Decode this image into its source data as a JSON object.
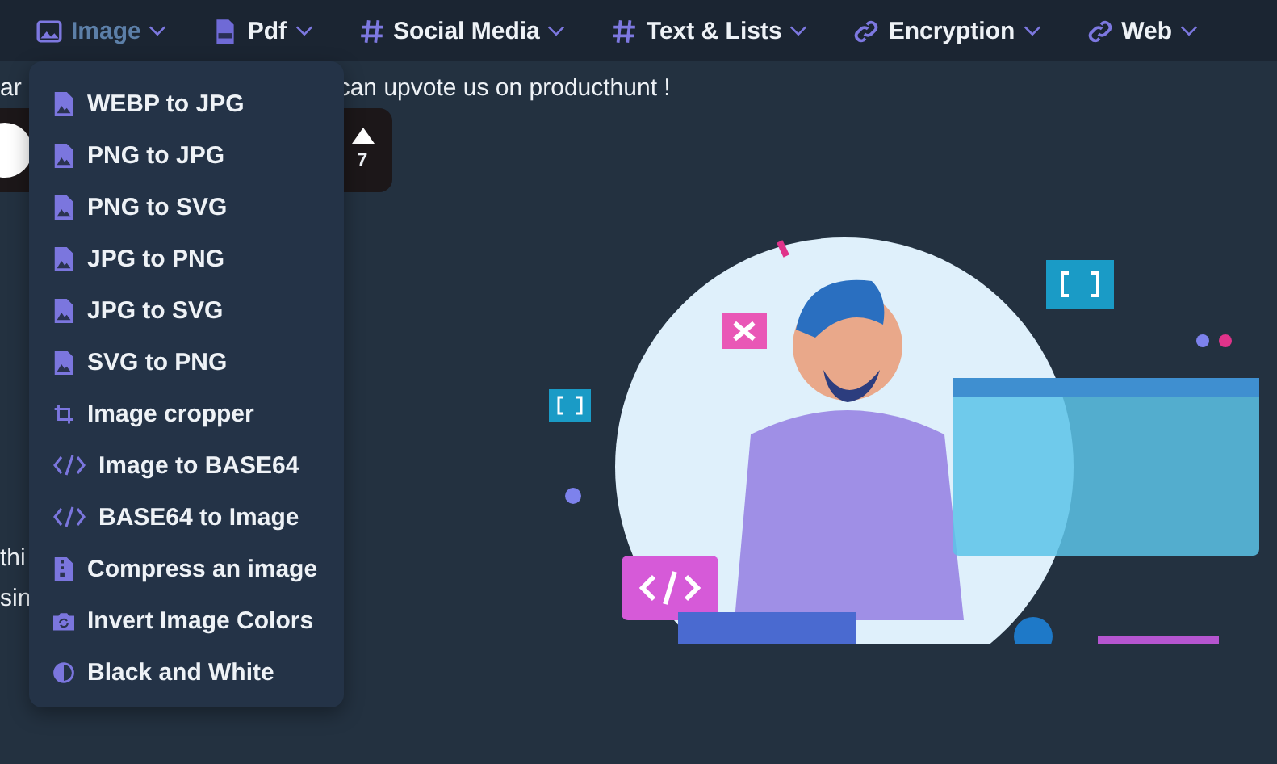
{
  "nav": [
    {
      "label": "Image",
      "kind": "image",
      "selected": true
    },
    {
      "label": "Pdf",
      "kind": "pdf",
      "selected": false
    },
    {
      "label": "Social Media",
      "kind": "hash",
      "selected": false
    },
    {
      "label": "Text & Lists",
      "kind": "hash",
      "selected": false
    },
    {
      "label": "Encryption",
      "kind": "link",
      "selected": false
    },
    {
      "label": "Web",
      "kind": "link",
      "selected": false
    }
  ],
  "intro": {
    "left": "ar",
    "right": "can upvote us on producthunt !"
  },
  "badge": {
    "count": "7"
  },
  "side_text": [
    "thi",
    "sin"
  ],
  "menu": [
    {
      "label": "WEBP to JPG",
      "kind": "file"
    },
    {
      "label": "PNG to JPG",
      "kind": "file"
    },
    {
      "label": "PNG to SVG",
      "kind": "file"
    },
    {
      "label": "JPG to PNG",
      "kind": "file"
    },
    {
      "label": "JPG to SVG",
      "kind": "file"
    },
    {
      "label": "SVG to PNG",
      "kind": "file"
    },
    {
      "label": "Image cropper",
      "kind": "crop"
    },
    {
      "label": "Image to BASE64",
      "kind": "code"
    },
    {
      "label": "BASE64 to Image",
      "kind": "code"
    },
    {
      "label": "Compress an image",
      "kind": "compress"
    },
    {
      "label": "Invert Image Colors",
      "kind": "invert"
    },
    {
      "label": "Black and White",
      "kind": "contrast"
    }
  ]
}
